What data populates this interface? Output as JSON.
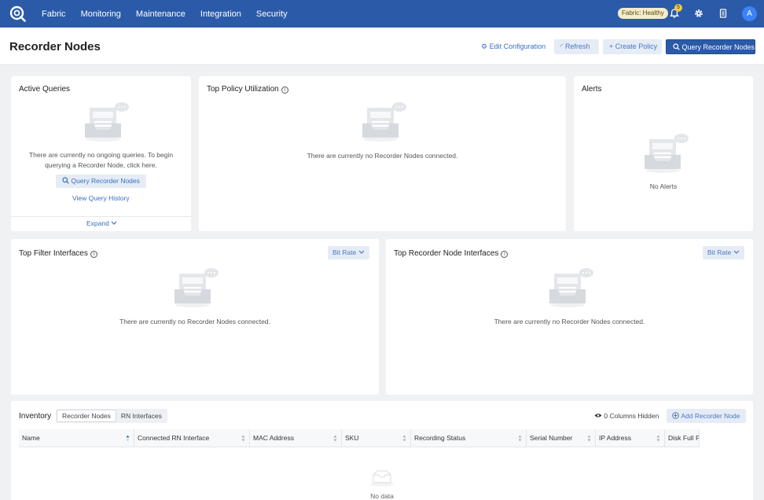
{
  "nav": {
    "items": [
      "Fabric",
      "Monitoring",
      "Maintenance",
      "Integration",
      "Security"
    ],
    "health_badge": "Fabric: Healthy",
    "notification_count": "5",
    "avatar_letter": "A"
  },
  "header": {
    "title": "Recorder Nodes",
    "edit_config": "Edit Configuration",
    "refresh": "Refresh",
    "create_policy": "Create Policy",
    "query_nodes": "Query Recorder Nodes"
  },
  "active_queries": {
    "title": "Active Queries",
    "message": "There are currently no ongoing queries. To begin querying a Recorder Node, click here.",
    "button": "Query Recorder Nodes",
    "history_link": "View Query History",
    "expand": "Expand"
  },
  "top_policy": {
    "title": "Top Policy Utilization",
    "message": "There are currently no Recorder Nodes connected."
  },
  "alerts": {
    "title": "Alerts",
    "message": "No Alerts"
  },
  "top_filter": {
    "title": "Top Filter Interfaces",
    "dropdown": "Bit Rate",
    "message": "There are currently no Recorder Nodes connected."
  },
  "top_rn_interfaces": {
    "title": "Top Recorder Node Interfaces",
    "dropdown": "Bit Rate",
    "message": "There are currently no Recorder Nodes connected."
  },
  "inventory": {
    "title": "Inventory",
    "tabs": [
      "Recorder Nodes",
      "RN Interfaces"
    ],
    "columns_hidden": "0 Columns Hidden",
    "add_button": "Add Recorder Node",
    "columns": [
      "Name",
      "Connected RN Interface",
      "MAC Address",
      "SKU",
      "Recording Status",
      "Serial Number",
      "IP Address",
      "Disk Full P"
    ],
    "no_data": "No data"
  },
  "colors": {
    "nav_bg": "#2a5aa8",
    "primary": "#2a5aa8",
    "link": "#3a6fc0",
    "health_badge_bg": "#f4eccb",
    "notif_badge_bg": "#f4c94a"
  }
}
